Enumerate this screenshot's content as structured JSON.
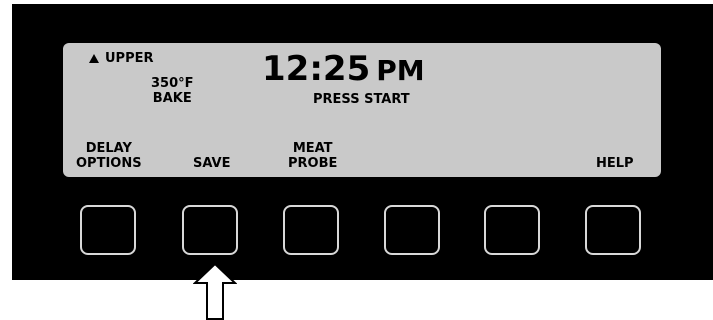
{
  "display": {
    "oven": "UPPER",
    "temperature": "350°F",
    "mode": "BAKE",
    "time": "12:25",
    "ampm": "PM",
    "prompt": "PRESS START"
  },
  "soft_labels": {
    "key1_line1": "DELAY",
    "key1_line2": "OPTIONS",
    "key2": "SAVE",
    "key3_line1": "MEAT",
    "key3_line2": "PROBE",
    "key6": "HELP"
  },
  "icons": {
    "oven_indicator": "up-triangle-icon",
    "pointer": "up-arrow-icon"
  },
  "colors": {
    "panel": "#000000",
    "lcd": "#c9c9c9",
    "key_border": "#d8d8d8"
  }
}
